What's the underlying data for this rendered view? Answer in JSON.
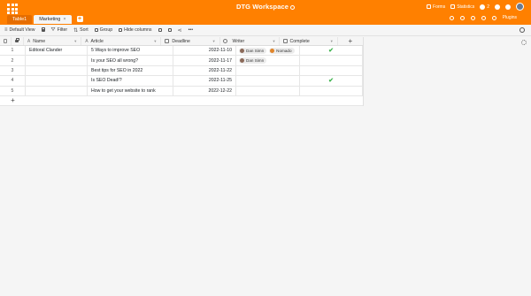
{
  "app": {
    "title": "DTG Workspace"
  },
  "top_right": {
    "forms": "Forms",
    "statistics": "Statistics",
    "collaborators": "2",
    "plugins": "Plugins"
  },
  "tabs": [
    {
      "label": "Table1",
      "active": false
    },
    {
      "label": "Marketing",
      "active": true
    }
  ],
  "tab_close": "×",
  "tab_add": "+",
  "toolbar": {
    "view": "Default View",
    "filter": "Filter",
    "sort": "Sort",
    "group": "Group",
    "hide_columns": "Hide columns",
    "more": "•••"
  },
  "columns": [
    "Name",
    "Article",
    "Deadline",
    "Writer",
    "Complete"
  ],
  "column_add": "+",
  "rows": [
    {
      "index": "1",
      "name": "Editoral Clander",
      "article": "5 Ways to improve SEO",
      "deadline": "2022-11-10",
      "writers": [
        "Dan Simn",
        "Nomado"
      ],
      "complete": true
    },
    {
      "index": "2",
      "name": "",
      "article": "Is your SEO all wrong?",
      "deadline": "2022-11-17",
      "writers": [
        "Dan Simn"
      ],
      "complete": false
    },
    {
      "index": "3",
      "name": "",
      "article": "Best tips for SEO in 2022",
      "deadline": "2022-11-22",
      "writers": [],
      "complete": false
    },
    {
      "index": "4",
      "name": "",
      "article": "Is SEO Dead!?",
      "deadline": "2022-11-25",
      "writers": [],
      "complete": true
    },
    {
      "index": "5",
      "name": "",
      "article": "How to get your website to rank",
      "deadline": "2022-12-22",
      "writers": [],
      "complete": false
    }
  ],
  "check_glyph": "✔",
  "add_row": "+",
  "colors": {
    "brand": "#ff8000",
    "check": "#3db34d"
  }
}
